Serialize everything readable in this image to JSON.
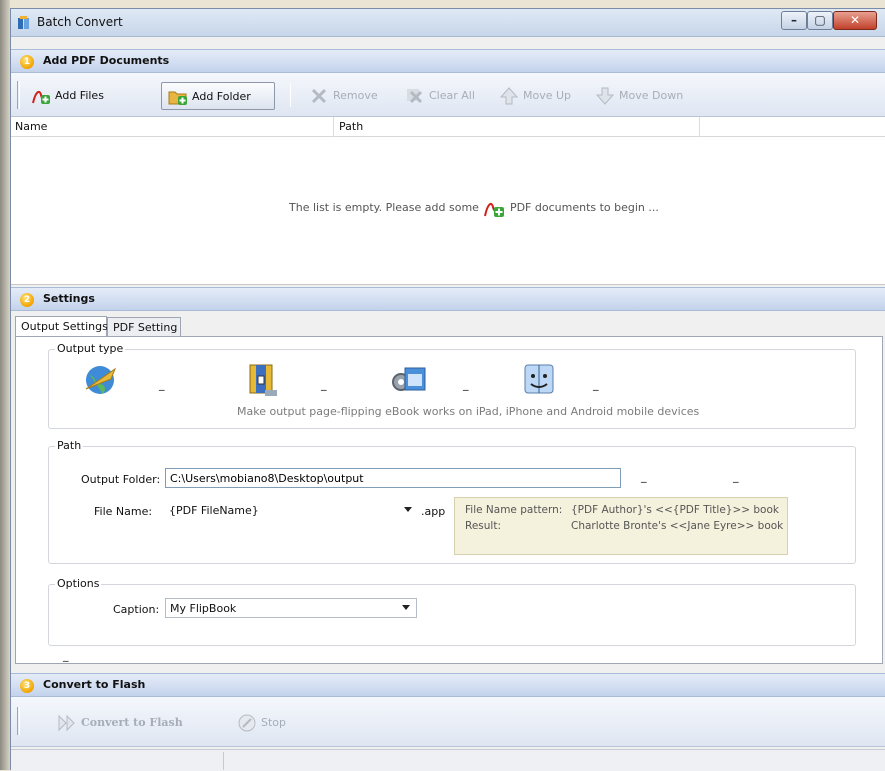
{
  "window": {
    "title": "Batch Convert"
  },
  "section1": {
    "number": "1",
    "title": "Add PDF Documents",
    "toolbar": {
      "add_files": "Add Files",
      "add_folder": "Add Folder",
      "remove": "Remove",
      "clear_all": "Clear All",
      "move_up": "Move Up",
      "move_down": "Move Down"
    },
    "list": {
      "columns": [
        "Name",
        "Path"
      ],
      "empty_before": "The list is empty. Please add some",
      "empty_after": "PDF documents to begin ..."
    }
  },
  "section2": {
    "number": "2",
    "title": "Settings",
    "tabs": [
      "Output Settings",
      "PDF Setting"
    ],
    "output_type": {
      "label": "Output type",
      "options": [
        "html",
        "zip",
        "exe",
        "app"
      ],
      "selected": "app",
      "hint": "Make output page-flipping eBook works on iPad, iPhone and Android mobile devices"
    },
    "path": {
      "label": "Path",
      "output_folder_label": "Output Folder:",
      "output_folder_value": "C:\\Users\\mobiano8\\Desktop\\output",
      "file_name_label": "File Name:",
      "file_name_value": "{PDF FileName}",
      "extension": ".app",
      "pattern_label": "File Name pattern:",
      "pattern_value": "{PDF Author}'s <<{PDF Title}>> book",
      "result_label": "Result:",
      "result_value": "Charlotte Bronte's <<Jane Eyre>> book"
    },
    "options": {
      "label": "Options",
      "caption_label": "Caption:",
      "caption_value": "My FlipBook"
    },
    "dash": "_"
  },
  "section3": {
    "number": "3",
    "title": "Convert to Flash",
    "convert_label": "Convert to Flash",
    "stop_label": "Stop"
  },
  "colors": {
    "header_gradient_top": "#e5ecf8",
    "header_gradient_bottom": "#c4d3ec",
    "badge": "#f2a400",
    "pdf_red": "#d0211c",
    "plus_green": "#3aa63a"
  }
}
